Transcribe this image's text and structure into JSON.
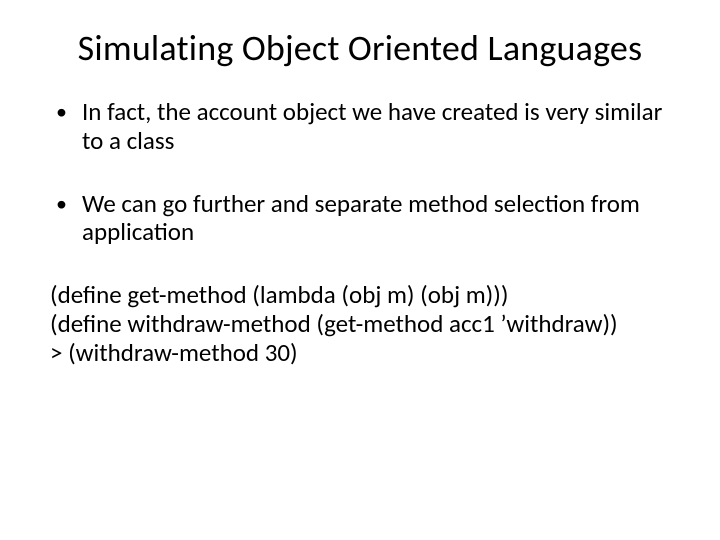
{
  "title": "Simulating Object Oriented Languages",
  "bullets": [
    "In fact, the account object we have created is very similar to a class",
    "We can go further and separate method selection from application"
  ],
  "code": {
    "line1": "(define get-method (lambda (obj m) (obj m)))",
    "line2": "(define withdraw-method (get-method acc1 ’withdraw))",
    "line3": "> (withdraw-method 30)"
  }
}
